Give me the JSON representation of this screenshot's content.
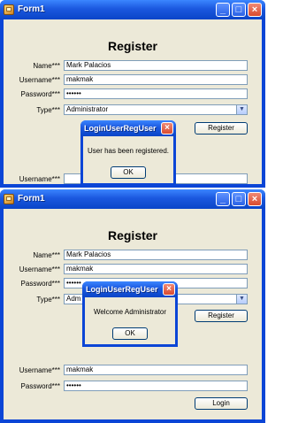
{
  "window1": {
    "title": "Form1",
    "heading": "Register",
    "fields": {
      "name_label": "Name***",
      "name_value": "Mark Palacios",
      "username_label": "Username***",
      "username_value": "makmak",
      "password_label": "Password***",
      "password_value": "••••••",
      "type_label": "Type***",
      "type_value": "Administrator"
    },
    "register_button": "Register",
    "login_username_label": "Username***",
    "dialog": {
      "title": "LoginUserRegUser",
      "message": "User has been registered.",
      "ok": "OK"
    }
  },
  "window2": {
    "title": "Form1",
    "heading": "Register",
    "fields": {
      "name_label": "Name***",
      "name_value": "Mark Palacios",
      "username_label": "Username***",
      "username_value": "makmak",
      "password_label": "Password***",
      "password_value": "••••••",
      "type_label": "Type***",
      "type_value": "Adm"
    },
    "register_button": "Register",
    "login": {
      "username_label": "Username***",
      "username_value": "makmak",
      "password_label": "Password***",
      "password_value": "••••••",
      "login_button": "Login"
    },
    "dialog": {
      "title": "LoginUserRegUser",
      "message": "Welcome Administrator",
      "ok": "OK"
    }
  }
}
